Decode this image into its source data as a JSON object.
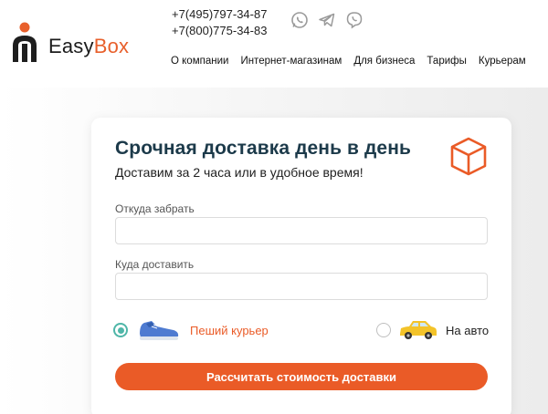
{
  "header": {
    "logo_text_1": "Easy",
    "logo_text_2": "Box",
    "phones": [
      "+7(495)797-34-87",
      "+7(800)775-34-83"
    ],
    "messengers": [
      "whatsapp-icon",
      "telegram-icon",
      "viber-icon"
    ],
    "nav": [
      "О компании",
      "Интернет-магазинам",
      "Для бизнеса",
      "Тарифы",
      "Курьерам"
    ]
  },
  "card": {
    "title": "Срочная доставка день в день",
    "subtitle": "Доставим за 2 часа или в удобное время!",
    "from_label": "Откуда забрать",
    "from_value": "",
    "to_label": "Куда доставить",
    "to_value": "",
    "options": [
      {
        "label": "Пеший курьер",
        "selected": true,
        "icon": "sneaker-icon"
      },
      {
        "label": "На авто",
        "selected": false,
        "icon": "car-icon"
      }
    ],
    "submit_label": "Рассчитать стоимость доставки"
  },
  "colors": {
    "accent": "#ea5b27",
    "title": "#1c3a4a",
    "radio_selected": "#4fb6a8"
  }
}
